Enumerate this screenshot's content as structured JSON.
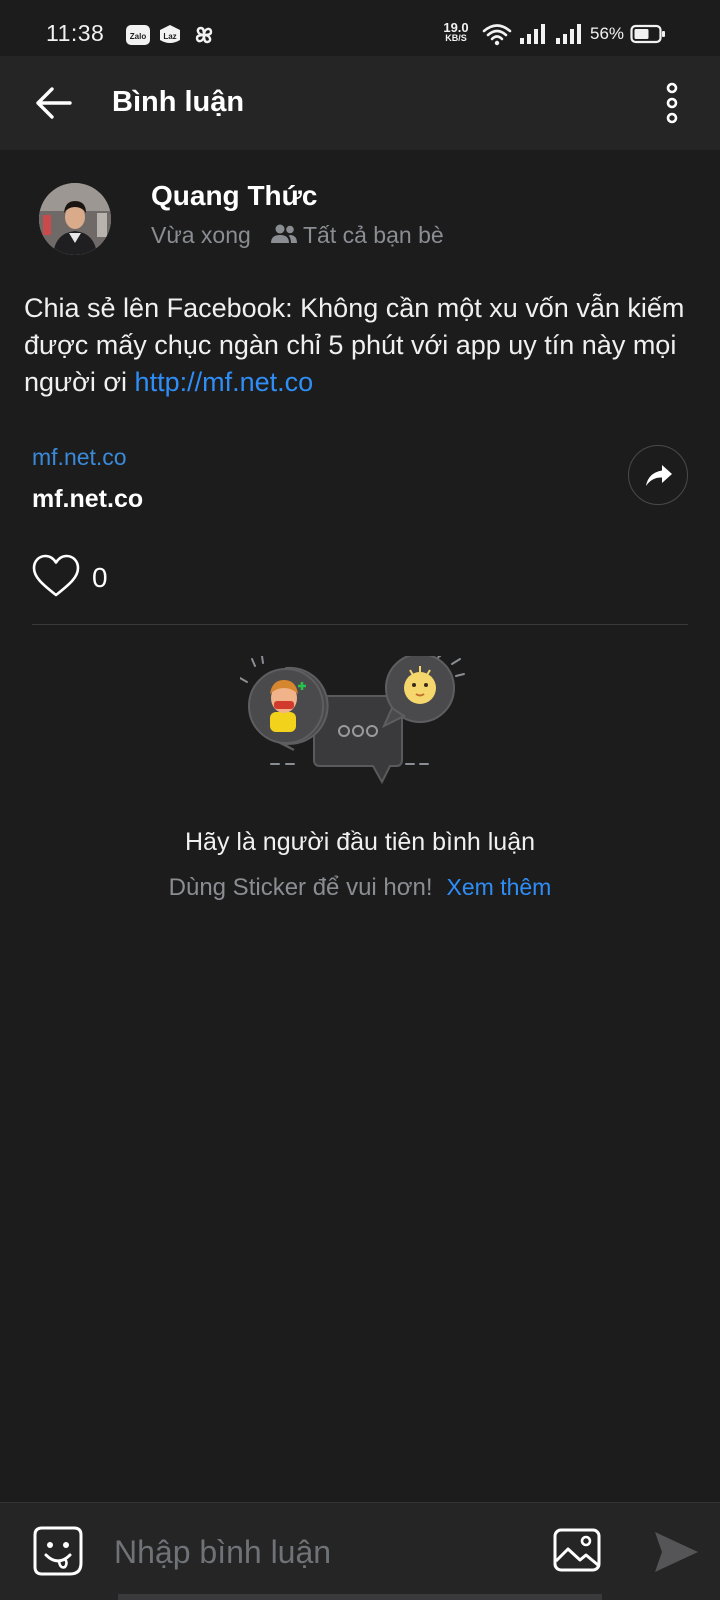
{
  "status_bar": {
    "time": "11:38",
    "apps": [
      "Zalo",
      "Laz"
    ],
    "net_speed_value": "19.0",
    "net_speed_unit": "KB/S",
    "battery": "56%"
  },
  "header": {
    "title": "Bình luận",
    "back_icon": "arrow-left-icon",
    "menu_icon": "more-vertical-icon"
  },
  "post": {
    "author": "Quang Thức",
    "time": "Vừa xong",
    "privacy": "Tất cả bạn bè",
    "text": "Chia sẻ lên Facebook: Không cần một xu vốn vẫn kiếm được mấy chục ngàn chỉ 5 phút với app uy tín này mọi người ơi",
    "link": "http://mf.net.co",
    "preview": {
      "domain": "mf.net.co",
      "title": "mf.net.co"
    },
    "like_count": "0"
  },
  "empty_state": {
    "title": "Hãy là người đầu tiên bình luận",
    "subtitle": "Dùng Sticker để vui hơn!",
    "more_link": "Xem thêm"
  },
  "composer": {
    "placeholder": "Nhập bình luận"
  },
  "colors": {
    "background": "#1c1c1d",
    "bar": "#252526",
    "accent": "#2f8ef6",
    "muted": "#8a8d91"
  }
}
